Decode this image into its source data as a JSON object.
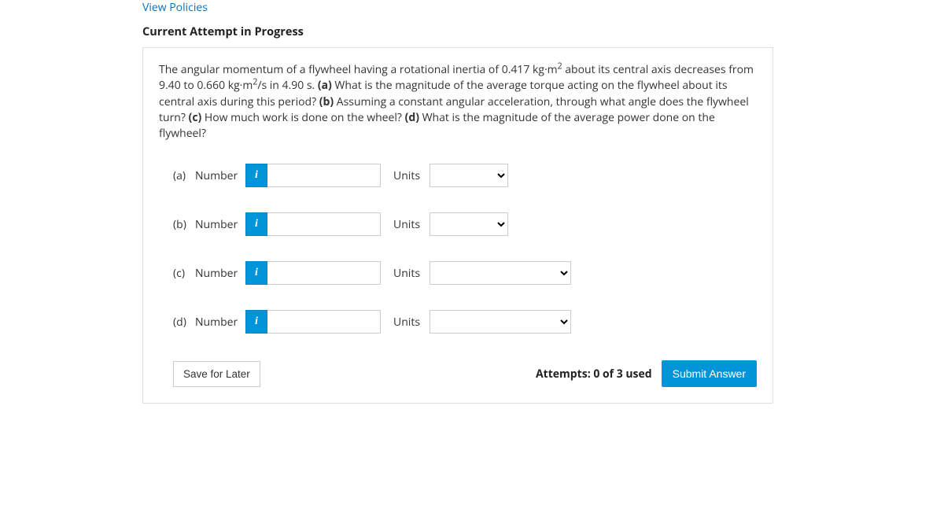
{
  "header": {
    "view_policies": "View Policies",
    "attempt_status": "Current Attempt in Progress"
  },
  "problem": {
    "text_1": "The angular momentum of a flywheel having a rotational inertia of 0.417 kg·m",
    "sup_1": "2",
    "text_2": " about its central axis decreases from 9.40 to 0.660 kg·m",
    "sup_2": "2",
    "text_3": "/s in 4.90 s. ",
    "bold_a": "(a)",
    "text_4": " What is the magnitude of the average torque acting on the flywheel about its central axis during this period? ",
    "bold_b": "(b)",
    "text_5": " Assuming a constant angular acceleration, through what angle does the flywheel turn? ",
    "bold_c": "(c)",
    "text_6": " How much work is done on the wheel? ",
    "bold_d": "(d)",
    "text_7": " What is the magnitude of the average power done on the flywheel?"
  },
  "labels": {
    "number": "Number",
    "units": "Units",
    "info_glyph": "i"
  },
  "parts": {
    "a": "(a)",
    "b": "(b)",
    "c": "(c)",
    "d": "(d)"
  },
  "footer": {
    "save": "Save for Later",
    "attempts": "Attempts: 0 of 3 used",
    "submit": "Submit Answer"
  }
}
